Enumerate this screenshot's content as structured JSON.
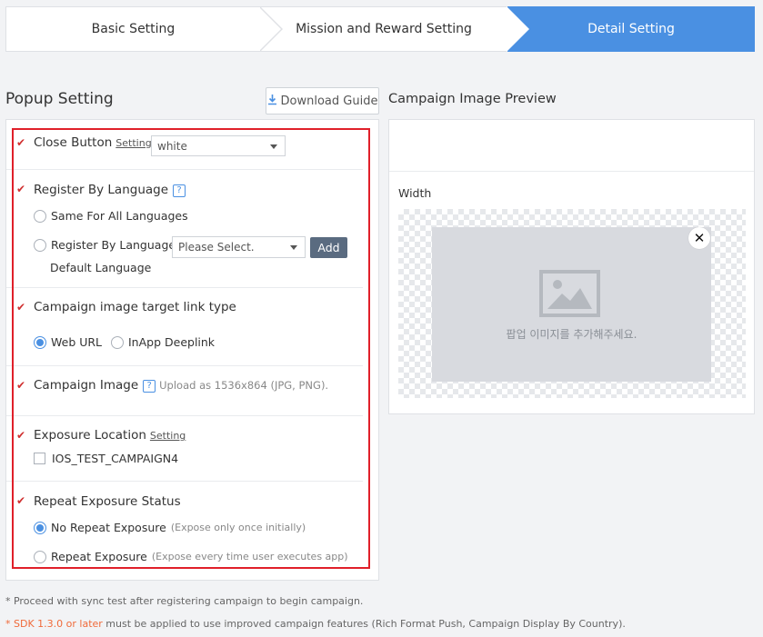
{
  "stepper": {
    "steps": [
      "Basic Setting",
      "Mission and Reward Setting",
      "Detail Setting"
    ],
    "active_index": 2,
    "active_color": "#4a90e2"
  },
  "popup": {
    "title": "Popup Setting",
    "download_label": "Download Guide",
    "close_button": {
      "label": "Close Button",
      "setting_link": "Setting",
      "value": "white"
    },
    "register_language": {
      "label": "Register By Language",
      "help": "?",
      "option_same": "Same For All Languages",
      "option_by_language": "Register By Language",
      "select_placeholder": "Please Select.",
      "add_label": "Add",
      "default_language_label": "Default Language"
    },
    "target_link": {
      "label": "Campaign image target link type",
      "option_web": "Web URL",
      "option_deeplink": "InApp Deeplink",
      "selected": "Web URL"
    },
    "campaign_image": {
      "label": "Campaign Image",
      "help": "?",
      "hint": "Upload as 1536x864 (JPG, PNG)."
    },
    "exposure_location": {
      "label": "Exposure Location",
      "setting_link": "Setting",
      "item": "IOS_TEST_CAMPAIGN4"
    },
    "repeat_status": {
      "label": "Repeat Exposure Status",
      "option_no": "No Repeat Exposure",
      "option_no_hint": "(Expose only once initially)",
      "option_repeat": "Repeat Exposure",
      "option_repeat_hint": "(Expose every time user executes app)",
      "selected": "No Repeat Exposure"
    },
    "highlight_color": "#e0202a"
  },
  "preview": {
    "title": "Campaign Image Preview",
    "width_label": "Width",
    "placeholder_text": "팝업 이미지를 추가해주세요.",
    "close_glyph": "✕"
  },
  "footnotes": {
    "line1": "* Proceed with sync test after registering campaign to begin campaign.",
    "line2_prefix": "* SDK 1.3.0 or later",
    "line2_rest": " must be applied to use improved campaign features (Rich Format Push, Campaign Display By Country)."
  }
}
